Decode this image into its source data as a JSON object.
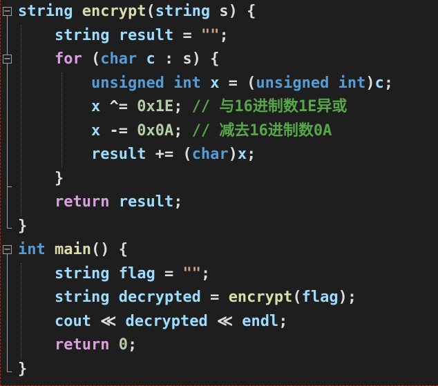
{
  "colors": {
    "background": "#1e1e1e",
    "keyword": "#569cd6",
    "control": "#d8a0df",
    "function": "#dcdcaa",
    "variable": "#9cdcfe",
    "string": "#d69d85",
    "number": "#b5cea8",
    "comment": "#57a64a",
    "punctuation": "#dcdcdc"
  },
  "code": {
    "lines": [
      [
        [
          "var",
          "string"
        ],
        [
          "op",
          " "
        ],
        [
          "fn",
          "encrypt"
        ],
        [
          "op",
          "("
        ],
        [
          "var",
          "string"
        ],
        [
          "op",
          " s) {"
        ]
      ],
      [
        [
          "op",
          "    "
        ],
        [
          "var",
          "string"
        ],
        [
          "op",
          " "
        ],
        [
          "var",
          "result"
        ],
        [
          "op",
          " = "
        ],
        [
          "str",
          "\"\""
        ],
        [
          "op",
          ";"
        ]
      ],
      [
        [
          "op",
          "    "
        ],
        [
          "ctl",
          "for"
        ],
        [
          "op",
          " ("
        ],
        [
          "kw",
          "char"
        ],
        [
          "op",
          " "
        ],
        [
          "var",
          "c"
        ],
        [
          "op",
          " : s) {"
        ]
      ],
      [
        [
          "op",
          "        "
        ],
        [
          "kw",
          "unsigned"
        ],
        [
          "op",
          " "
        ],
        [
          "kw",
          "int"
        ],
        [
          "op",
          " "
        ],
        [
          "var",
          "x"
        ],
        [
          "op",
          " = ("
        ],
        [
          "kw",
          "unsigned"
        ],
        [
          "op",
          " "
        ],
        [
          "kw",
          "int"
        ],
        [
          "op",
          ")"
        ],
        [
          "var",
          "c"
        ],
        [
          "op",
          ";"
        ]
      ],
      [
        [
          "op",
          "        "
        ],
        [
          "var",
          "x"
        ],
        [
          "op",
          " ^= "
        ],
        [
          "num",
          "0x1E"
        ],
        [
          "op",
          "; "
        ],
        [
          "cmt",
          "// 与16进制数1E异或"
        ]
      ],
      [
        [
          "op",
          "        "
        ],
        [
          "var",
          "x"
        ],
        [
          "op",
          " -= "
        ],
        [
          "num",
          "0x0A"
        ],
        [
          "op",
          "; "
        ],
        [
          "cmt",
          "// 减去16进制数0A"
        ]
      ],
      [
        [
          "op",
          "        "
        ],
        [
          "var",
          "result"
        ],
        [
          "op",
          " += ("
        ],
        [
          "kw",
          "char"
        ],
        [
          "op",
          ")"
        ],
        [
          "var",
          "x"
        ],
        [
          "op",
          ";"
        ]
      ],
      [
        [
          "op",
          "    }"
        ]
      ],
      [
        [
          "op",
          "    "
        ],
        [
          "ctl",
          "return"
        ],
        [
          "op",
          " "
        ],
        [
          "var",
          "result"
        ],
        [
          "op",
          ";"
        ]
      ],
      [
        [
          "op",
          "}"
        ]
      ],
      [
        [
          "kw",
          "int"
        ],
        [
          "op",
          " "
        ],
        [
          "fn",
          "main"
        ],
        [
          "op",
          "() {"
        ]
      ],
      [
        [
          "op",
          "    "
        ],
        [
          "var",
          "string"
        ],
        [
          "op",
          " "
        ],
        [
          "var",
          "flag"
        ],
        [
          "op",
          " = "
        ],
        [
          "str",
          "\"\""
        ],
        [
          "op",
          ";"
        ]
      ],
      [
        [
          "op",
          "    "
        ],
        [
          "var",
          "string"
        ],
        [
          "op",
          " "
        ],
        [
          "var",
          "decrypted"
        ],
        [
          "op",
          " = "
        ],
        [
          "fn",
          "encrypt"
        ],
        [
          "op",
          "("
        ],
        [
          "var",
          "flag"
        ],
        [
          "op",
          ");"
        ]
      ],
      [
        [
          "op",
          "    "
        ],
        [
          "var",
          "cout"
        ],
        [
          "op",
          " ≪ "
        ],
        [
          "var",
          "decrypted"
        ],
        [
          "op",
          " ≪ "
        ],
        [
          "var",
          "endl"
        ],
        [
          "op",
          ";"
        ]
      ],
      [
        [
          "op",
          "    "
        ],
        [
          "ctl",
          "return"
        ],
        [
          "op",
          " "
        ],
        [
          "num",
          "0"
        ],
        [
          "op",
          ";"
        ]
      ],
      [
        [
          "op",
          "}"
        ]
      ]
    ]
  },
  "gutter": {
    "fold_icon": "minus-box-icon",
    "fold_glyph": "−"
  }
}
